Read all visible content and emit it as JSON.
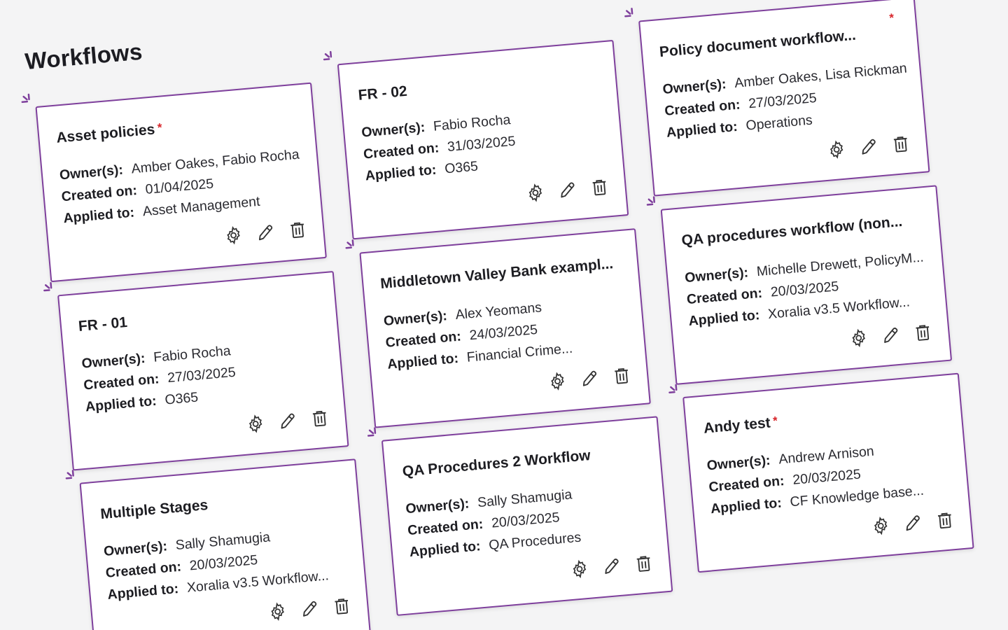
{
  "page": {
    "title": "Workflows"
  },
  "colors": {
    "card_border": "#7e3f9c",
    "required_marker": "#d8262b",
    "background": "#f4f4f5"
  },
  "labels": {
    "owners": "Owner(s):",
    "created": "Created on:",
    "applied": "Applied to:"
  },
  "icons": [
    "settings-gear-icon",
    "edit-pencil-icon",
    "delete-trash-icon"
  ],
  "required_marker": "*",
  "cards": [
    {
      "title": "Asset policies",
      "required": true,
      "owners": "Amber Oakes, Fabio Rocha",
      "created": "01/04/2025",
      "applied": "Asset Management"
    },
    {
      "title": "FR - 02",
      "required": false,
      "owners": "Fabio Rocha",
      "created": "31/03/2025",
      "applied": "O365"
    },
    {
      "title": "Policy document workflow...",
      "required": true,
      "owners": "Amber Oakes, Lisa Rickman",
      "created": "27/03/2025",
      "applied": "Operations"
    },
    {
      "title": "FR - 01",
      "required": false,
      "owners": "Fabio Rocha",
      "created": "27/03/2025",
      "applied": "O365"
    },
    {
      "title": "Middletown Valley Bank exampl...",
      "required": false,
      "owners": "Alex Yeomans",
      "created": "24/03/2025",
      "applied": "Financial Crime..."
    },
    {
      "title": "QA procedures workflow (non...",
      "required": false,
      "owners": "Michelle Drewett, PolicyM...",
      "created": "20/03/2025",
      "applied": "Xoralia v3.5 Workflow..."
    },
    {
      "title": "Multiple Stages",
      "required": false,
      "owners": "Sally Shamugia",
      "created": "20/03/2025",
      "applied": "Xoralia v3.5 Workflow..."
    },
    {
      "title": "QA Procedures 2 Workflow",
      "required": false,
      "owners": "Sally Shamugia",
      "created": "20/03/2025",
      "applied": "QA Procedures"
    },
    {
      "title": "Andy test",
      "required": true,
      "owners": "Andrew Arnison",
      "created": "20/03/2025",
      "applied": "CF Knowledge base..."
    }
  ]
}
